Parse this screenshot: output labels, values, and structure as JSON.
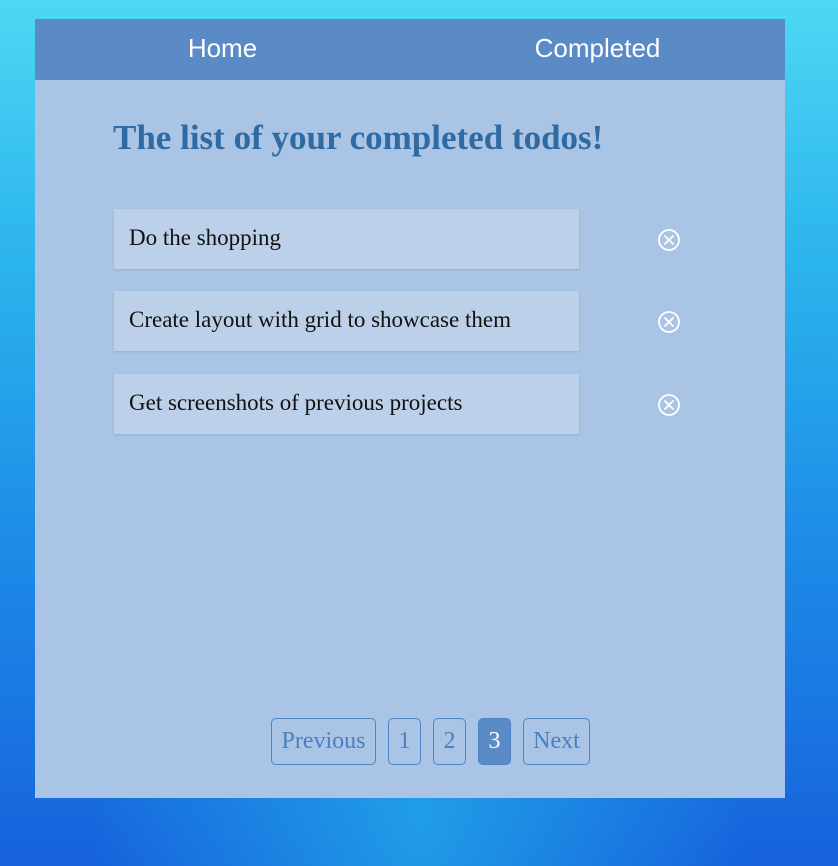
{
  "nav": {
    "home_label": "Home",
    "completed_label": "Completed"
  },
  "main": {
    "title": "The list of your completed todos!",
    "todos": [
      {
        "text": "Do the shopping"
      },
      {
        "text": "Create layout with grid to showcase them"
      },
      {
        "text": "Get screenshots of previous projects"
      }
    ]
  },
  "pagination": {
    "previous_label": "Previous",
    "pages": [
      "1",
      "2",
      "3"
    ],
    "current_page": "3",
    "next_label": "Next"
  },
  "icons": {
    "remove": "circle-x-icon"
  },
  "colors": {
    "nav_background": "#5a8bc6",
    "panel_background": "#a9c4e4",
    "todo_background": "#bcd0ea",
    "title_color": "#2f6aa3",
    "active_page": "#5a8bc6"
  }
}
